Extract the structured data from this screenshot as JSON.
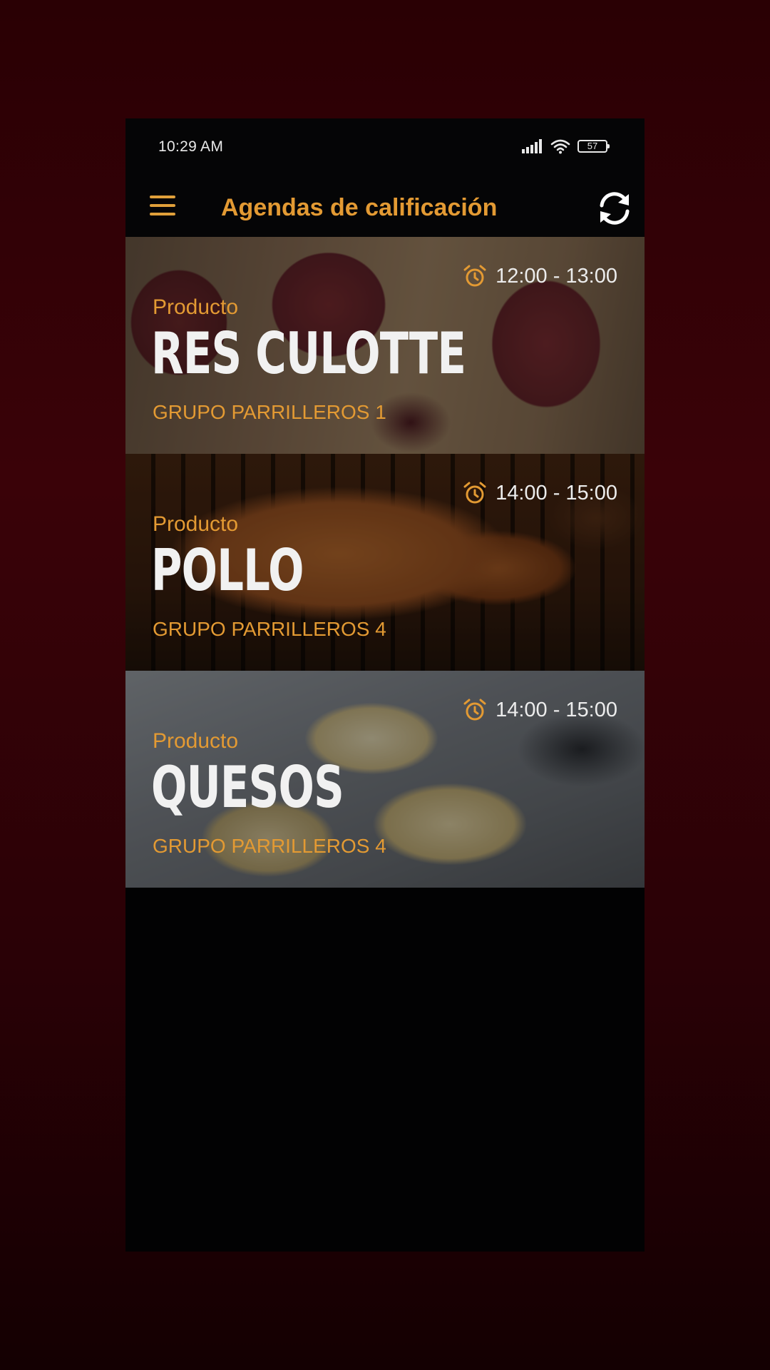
{
  "status_bar": {
    "time": "10:29 AM",
    "battery": "57"
  },
  "app_bar": {
    "title": "Agendas de calificación",
    "menu_icon": "hamburger-menu-icon",
    "refresh_icon": "refresh-icon"
  },
  "cards": [
    {
      "time": "12:00 - 13:00",
      "label": "Producto",
      "product": "RES CULOTTE",
      "group": "GRUPO PARRILLEROS 1",
      "background": "beef-steaks-photo"
    },
    {
      "time": "14:00 - 15:00",
      "label": "Producto",
      "product": "POLLO",
      "group": "GRUPO PARRILLEROS 4",
      "background": "roast-chicken-photo"
    },
    {
      "time": "14:00 - 15:00",
      "label": "Producto",
      "product": "QUESOS",
      "group": "GRUPO PARRILLEROS 4",
      "background": "cheese-wheels-photo"
    }
  ],
  "colors": {
    "accent": "#e39a33",
    "background": "#020203",
    "outer": "#2a0004"
  }
}
